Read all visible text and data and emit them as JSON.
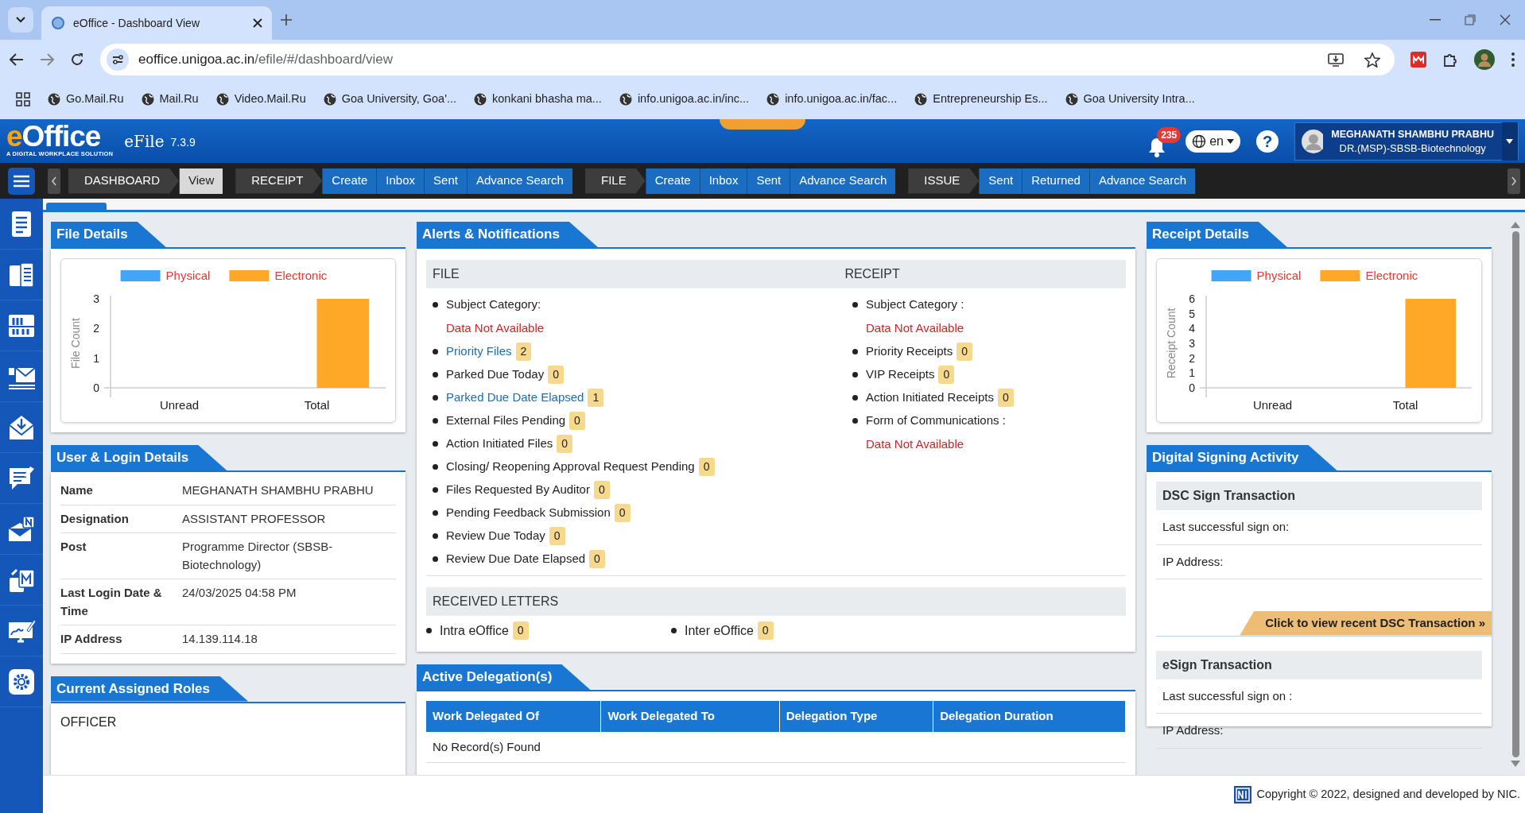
{
  "browser": {
    "tab_title": "eOffice - Dashboard View",
    "url_host": "eoffice.unigoa.ac.in",
    "url_path": "/efile/#/dashboard/view",
    "bookmarks": [
      "Go.Mail.Ru",
      "Mail.Ru",
      "Video.Mail.Ru",
      "Goa University, Goa'...",
      "konkani bhasha ma...",
      "info.unigoa.ac.in/inc...",
      "info.unigoa.ac.in/fac...",
      "Entrepreneurship Es...",
      "Goa University Intra..."
    ]
  },
  "header": {
    "logo_text": "eOffice",
    "logo_tagline": "A DIGITAL WORKPLACE SOLUTION",
    "product": "eFile",
    "version": "7.3.9",
    "notification_count": "235",
    "language": "en",
    "help": "?",
    "user_name": "MEGHANATH SHAMBHU PRABHU",
    "user_role": "DR.(MSP)-SBSB-Biotechnology"
  },
  "nav_groups": [
    {
      "label": "DASHBOARD",
      "links": [
        {
          "label": "View",
          "selected": true
        }
      ]
    },
    {
      "label": "RECEIPT",
      "links": [
        {
          "label": "Create",
          "selected": false
        },
        {
          "label": "Inbox",
          "selected": false
        },
        {
          "label": "Sent",
          "selected": false
        },
        {
          "label": "Advance Search",
          "selected": false
        }
      ]
    },
    {
      "label": "FILE",
      "links": [
        {
          "label": "Create",
          "selected": false
        },
        {
          "label": "Inbox",
          "selected": false
        },
        {
          "label": "Sent",
          "selected": false
        },
        {
          "label": "Advance Search",
          "selected": false
        }
      ]
    },
    {
      "label": "ISSUE",
      "links": [
        {
          "label": "Sent",
          "selected": false
        },
        {
          "label": "Returned",
          "selected": false
        },
        {
          "label": "Advance Search",
          "selected": false
        }
      ]
    }
  ],
  "file_details": {
    "title": "File Details",
    "chart_data": {
      "type": "bar",
      "ylabel": "File Count",
      "categories": [
        "Unread",
        "Total"
      ],
      "ylim": [
        0,
        3
      ],
      "yticks": [
        0,
        1,
        2,
        3
      ],
      "series": [
        {
          "name": "Physical",
          "color": "#42a5f5",
          "values": [
            0,
            0
          ]
        },
        {
          "name": "Electronic",
          "color": "#ffa726",
          "values": [
            0,
            3
          ]
        }
      ]
    }
  },
  "user_login": {
    "title": "User & Login Details",
    "rows": [
      {
        "label": "Name",
        "value": "MEGHANATH SHAMBHU PRABHU"
      },
      {
        "label": "Designation",
        "value": "ASSISTANT PROFESSOR"
      },
      {
        "label": "Post",
        "value": "Programme Director (SBSB-Biotechnology)"
      },
      {
        "label": "Last Login Date & Time",
        "value": "24/03/2025 04:58 PM"
      },
      {
        "label": "IP Address",
        "value": "14.139.114.18"
      }
    ]
  },
  "roles": {
    "title": "Current Assigned Roles",
    "items": [
      "OFFICER"
    ]
  },
  "alerts": {
    "title": "Alerts & Notifications",
    "file": {
      "heading": "FILE",
      "items": [
        {
          "kind": "label",
          "label": "Subject Category:"
        },
        {
          "kind": "note",
          "label": "Data Not Available"
        },
        {
          "kind": "count",
          "label": "Priority Files",
          "count": "2",
          "link": true
        },
        {
          "kind": "count",
          "label": "Parked Due Today",
          "count": "0",
          "link": false
        },
        {
          "kind": "count",
          "label": "Parked Due Date Elapsed",
          "count": "1",
          "link": true
        },
        {
          "kind": "count",
          "label": "External Files Pending",
          "count": "0",
          "link": false
        },
        {
          "kind": "count",
          "label": "Action Initiated Files",
          "count": "0",
          "link": false
        },
        {
          "kind": "count",
          "label": "Closing/ Reopening Approval Request Pending",
          "count": "0",
          "link": false
        },
        {
          "kind": "count",
          "label": "Files Requested By Auditor",
          "count": "0",
          "link": false
        },
        {
          "kind": "count",
          "label": "Pending Feedback Submission",
          "count": "0",
          "link": false
        },
        {
          "kind": "count",
          "label": "Review Due Today",
          "count": "0",
          "link": false
        },
        {
          "kind": "count",
          "label": "Review Due Date Elapsed",
          "count": "0",
          "link": false
        }
      ]
    },
    "receipt": {
      "heading": "RECEIPT",
      "items": [
        {
          "kind": "label",
          "label": "Subject Category :"
        },
        {
          "kind": "note",
          "label": "Data Not Available"
        },
        {
          "kind": "count",
          "label": "Priority Receipts",
          "count": "0",
          "link": false
        },
        {
          "kind": "count",
          "label": "VIP Receipts",
          "count": "0",
          "link": false
        },
        {
          "kind": "count",
          "label": "Action Initiated Receipts",
          "count": "0",
          "link": false
        },
        {
          "kind": "label",
          "label": "Form of Communications :"
        },
        {
          "kind": "note",
          "label": "Data Not Available"
        }
      ]
    },
    "received_letters": {
      "heading": "RECEIVED LETTERS",
      "items": [
        {
          "kind": "count",
          "label": "Intra eOffice",
          "count": "0",
          "link": false
        },
        {
          "kind": "count",
          "label": "Inter eOffice",
          "count": "0",
          "link": false
        }
      ]
    }
  },
  "delegations": {
    "title": "Active Delegation(s)",
    "columns": [
      "Work Delegated Of",
      "Work Delegated To",
      "Delegation Type",
      "Delegation Duration"
    ],
    "empty_message": "No Record(s) Found"
  },
  "receipt_details": {
    "title": "Receipt Details",
    "chart_data": {
      "type": "bar",
      "ylabel": "Receipt Count",
      "categories": [
        "Unread",
        "Total"
      ],
      "ylim": [
        0,
        6
      ],
      "yticks": [
        0,
        1,
        2,
        3,
        4,
        5,
        6
      ],
      "series": [
        {
          "name": "Physical",
          "color": "#42a5f5",
          "values": [
            0,
            0
          ]
        },
        {
          "name": "Electronic",
          "color": "#ffa726",
          "values": [
            0,
            6
          ]
        }
      ]
    }
  },
  "digital_signing": {
    "title": "Digital Signing Activity",
    "sections": [
      {
        "heading": "DSC Sign Transaction",
        "rows": [
          "Last successful sign on:",
          "IP Address:"
        ],
        "action": "Click to view recent DSC Transaction »"
      },
      {
        "heading": "eSign Transaction",
        "rows": [
          "Last successful sign on :",
          "IP Address:"
        ]
      }
    ]
  },
  "footer": {
    "copyright": "Copyright © 2022, designed and developed by NIC."
  }
}
